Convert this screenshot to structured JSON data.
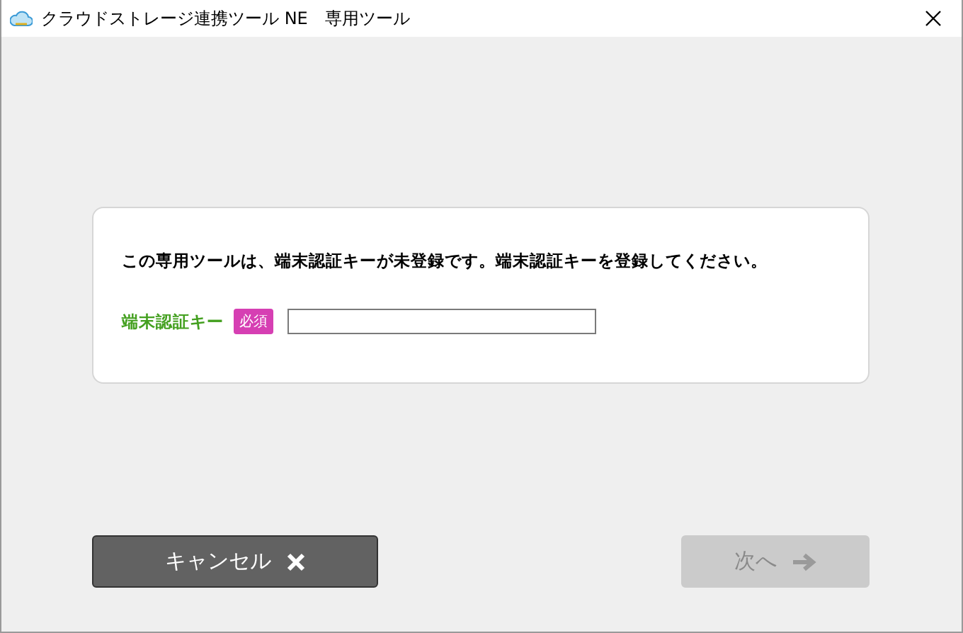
{
  "window": {
    "title": "クラウドストレージ連携ツール NE　専用ツール"
  },
  "card": {
    "message": "この専用ツールは、端末認証キーが未登録です。端末認証キーを登録してください。",
    "field": {
      "label": "端末認証キー",
      "badge": "必須"
    }
  },
  "buttons": [
    {
      "label": "キャンセル",
      "kind": "cancel",
      "disabled": false
    },
    {
      "label": "次へ",
      "kind": "next",
      "disabled": true
    }
  ]
}
